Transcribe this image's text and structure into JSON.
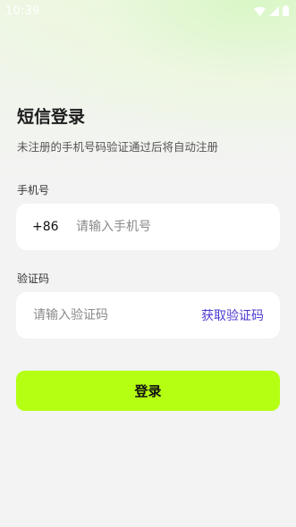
{
  "status_bar": {
    "time": "10:39",
    "icons": [
      "wifi-icon",
      "cellular-signal-icon",
      "battery-icon"
    ]
  },
  "page": {
    "title": "短信登录",
    "subtitle": "未注册的手机号码验证通过后将自动注册"
  },
  "phone": {
    "label": "手机号",
    "country_code": "+86",
    "placeholder": "请输入手机号",
    "value": ""
  },
  "code": {
    "label": "验证码",
    "placeholder": "请输入验证码",
    "value": "",
    "get_code_label": "获取验证码"
  },
  "login_button": {
    "label": "登录"
  },
  "colors": {
    "accent_button": "#b4ff12",
    "link": "#4a3ad0",
    "background": "#f3f3f3"
  }
}
